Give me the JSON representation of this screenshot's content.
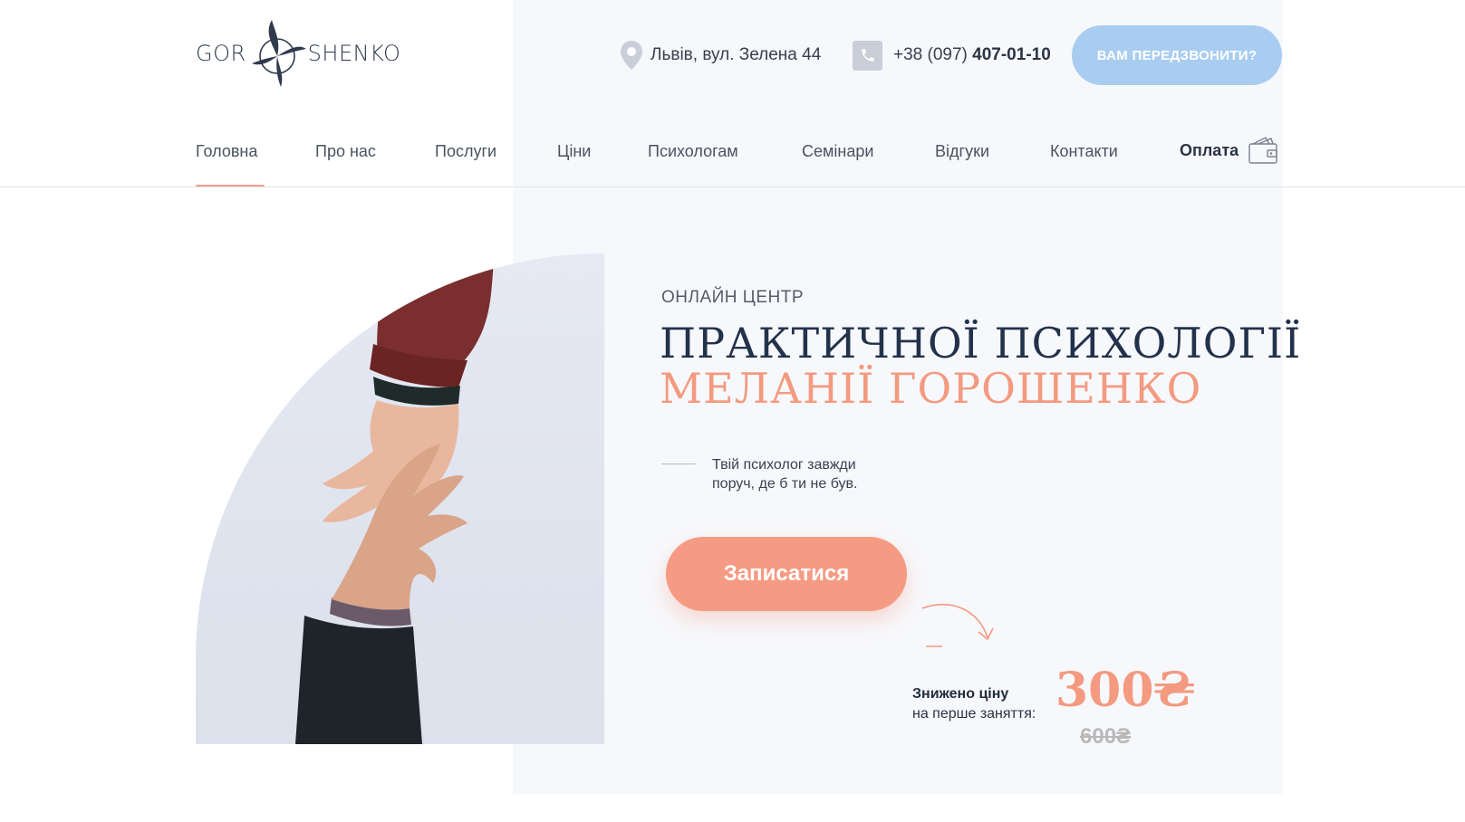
{
  "logo": {
    "left_text": "GOR",
    "right_text": "SHENKO"
  },
  "header": {
    "address": "Львів, вул. Зелена 44",
    "phone_prefix": "+38 (097)",
    "phone_number": "407-01-10",
    "callback_label": "ВАМ ПЕРЕДЗВОНИТИ?"
  },
  "nav": {
    "items": [
      {
        "label": "Головна"
      },
      {
        "label": "Про нас"
      },
      {
        "label": "Послуги"
      },
      {
        "label": "Ціни"
      },
      {
        "label": "Психологам"
      },
      {
        "label": "Семінари"
      },
      {
        "label": "Відгуки"
      },
      {
        "label": "Контакти"
      }
    ],
    "pay_label": "Оплата",
    "active": "Головна"
  },
  "hero": {
    "subtitle": "ОНЛАЙН ЦЕНТР",
    "title_line1": "ПРАКТИЧНОЇ ПСИХОЛОГІЇ",
    "title_line2": "МЕЛАНІЇ ГОРОШЕНКО",
    "tagline_line1": "Твій психолог завжди",
    "tagline_line2": "поруч, де б ти не був.",
    "signup_label": "Записатися"
  },
  "offer": {
    "discount_bold": "Знижено ціну",
    "discount_text": "на перше заняття:",
    "price_new": "300₴",
    "price_old": "600₴"
  },
  "colors": {
    "accent": "#f59b83",
    "dark": "#23324b",
    "callback_bg": "#a9cdf0",
    "panel_bg": "#f7f8fb"
  },
  "icons": {
    "logo_mark": "swallow-bird-icon",
    "address": "map-pin-icon",
    "phone": "phone-icon",
    "pay": "wallet-icon"
  }
}
